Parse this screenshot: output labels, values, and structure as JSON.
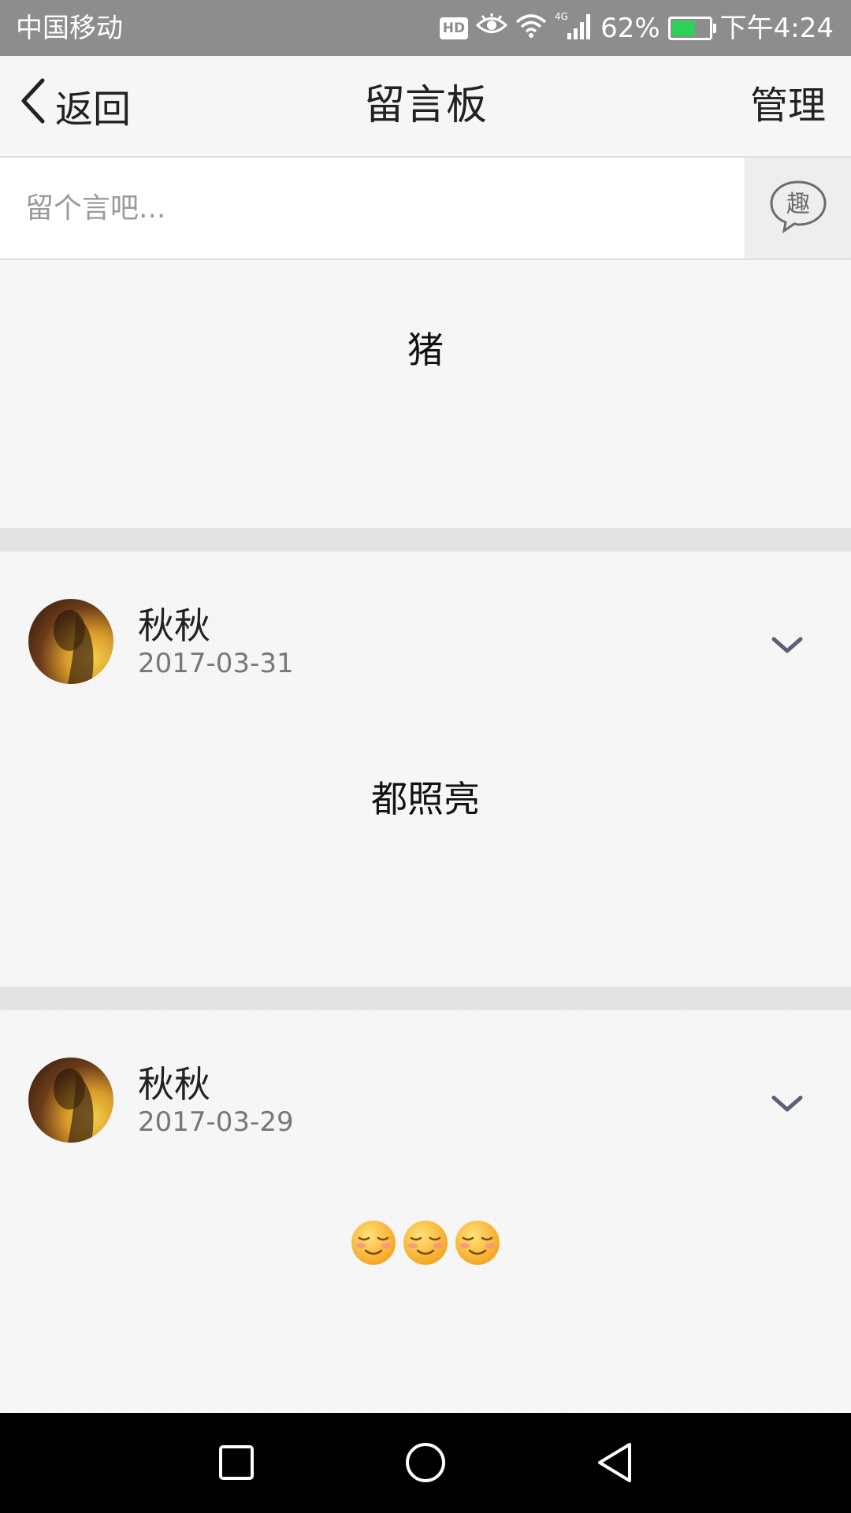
{
  "status_bar": {
    "carrier": "中国移动",
    "hd": "HD",
    "network": "4G",
    "battery_percent": "62%",
    "battery_level": 0.62,
    "time": "下午4:24"
  },
  "title_bar": {
    "back_label": "返回",
    "title": "留言板",
    "manage_label": "管理"
  },
  "input": {
    "placeholder": "留个言吧...",
    "value": "",
    "fun_button_label": "趣"
  },
  "messages": [
    {
      "author": "",
      "date": "",
      "text": "猪"
    },
    {
      "author": "秋秋",
      "date": "2017-03-31",
      "text": "都照亮"
    },
    {
      "author": "秋秋",
      "date": "2017-03-29",
      "text": "",
      "emoji_icons": [
        "smiling-face-icon",
        "smiling-face-icon",
        "smiling-face-icon"
      ]
    }
  ],
  "nav_bar": {
    "icons": [
      "recent-apps-icon",
      "home-icon",
      "back-triangle-icon"
    ]
  },
  "colors": {
    "status_bar_bg": "#8d8d8d",
    "battery_fill": "#2ed158",
    "expand_icon": "#5a6178",
    "divider": "#e3e3e3"
  }
}
